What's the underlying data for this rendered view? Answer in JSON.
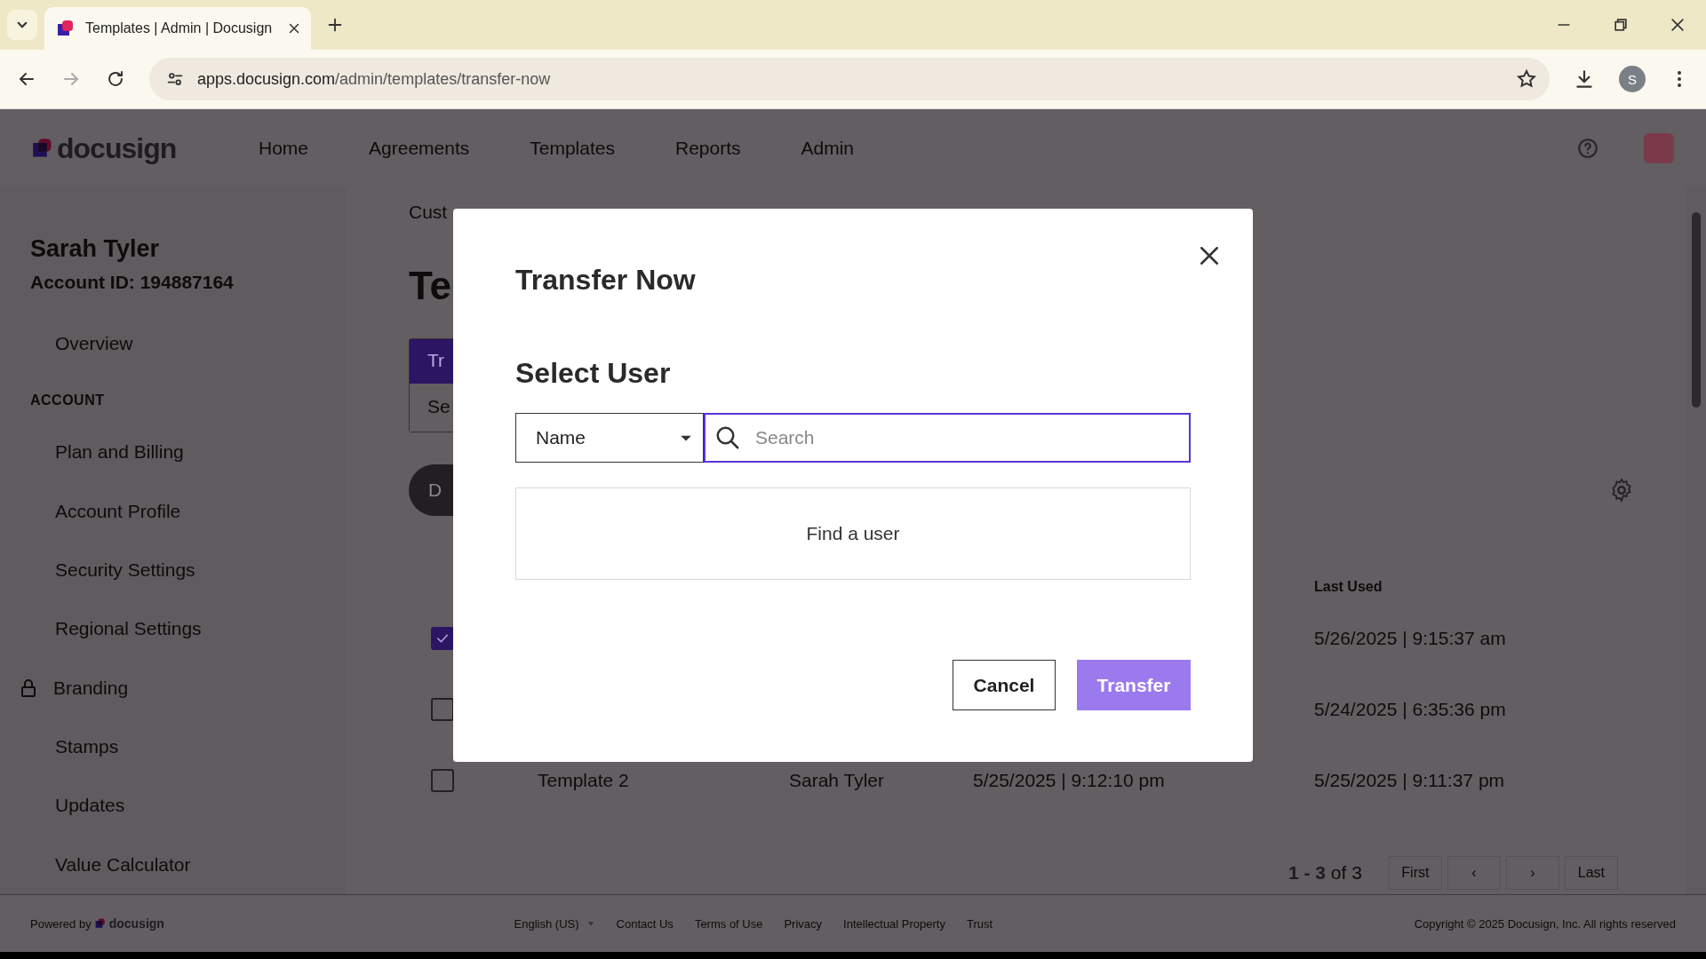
{
  "browser": {
    "tabs": [
      {
        "title": "Templates | Admin | Docusign",
        "selected": true
      }
    ],
    "url_host": "apps.docusign.com",
    "url_path": "/admin/templates/transfer-now",
    "profile_initial": "S"
  },
  "header": {
    "logo": "docusign",
    "nav": [
      {
        "label": "Home"
      },
      {
        "label": "Agreements"
      },
      {
        "label": "Templates"
      },
      {
        "label": "Reports"
      },
      {
        "label": "Admin"
      }
    ]
  },
  "sidebar": {
    "user_name": "Sarah Tyler",
    "account_id": "Account ID: 194887164",
    "items": [
      {
        "kind": "link",
        "label": "Overview",
        "locked": false
      },
      {
        "kind": "section",
        "label": "ACCOUNT"
      },
      {
        "kind": "link",
        "label": "Plan and Billing",
        "locked": false
      },
      {
        "kind": "link",
        "label": "Account Profile",
        "locked": false
      },
      {
        "kind": "link",
        "label": "Security Settings",
        "locked": false
      },
      {
        "kind": "link",
        "label": "Regional Settings",
        "locked": false
      },
      {
        "kind": "link",
        "label": "Branding",
        "locked": true
      },
      {
        "kind": "link",
        "label": "Stamps",
        "locked": false
      },
      {
        "kind": "link",
        "label": "Updates",
        "locked": false
      },
      {
        "kind": "link",
        "label": "Value Calculator",
        "locked": false
      }
    ]
  },
  "main": {
    "breadcrumb": "Cust",
    "title": "Te",
    "panel_header": "Tr",
    "panel_field": "Se",
    "action_button": "D",
    "table": {
      "columns": [
        {
          "label": "Last Used"
        }
      ],
      "rows": [
        {
          "checked": true,
          "last_used": "5/26/2025 | 9:15:37 am"
        },
        {
          "checked": false,
          "last_used": "5/24/2025 | 6:35:36 pm"
        },
        {
          "checked": false,
          "name": "Template 2",
          "owner": "Sarah Tyler",
          "created": "5/25/2025 | 9:12:10 pm",
          "last_used": "5/25/2025 | 9:11:37 pm"
        }
      ]
    },
    "pagination": {
      "range": "**1 - 3** of 3",
      "buttons": [
        "First",
        "‹",
        "›",
        "Last"
      ]
    }
  },
  "modal": {
    "title": "Transfer Now",
    "section_title": "Select User",
    "filter": {
      "value": "Name"
    },
    "search": {
      "placeholder": "Search"
    },
    "empty_text": "Find a user",
    "buttons": [
      {
        "label": "Cancel",
        "kind": "secondary",
        "disabled": false
      },
      {
        "label": "Transfer",
        "kind": "primary",
        "disabled": true
      }
    ]
  },
  "footer": {
    "powered_by": "Powered by",
    "logo": "docusign",
    "language": "English (US)",
    "links": [
      "Contact Us",
      "Terms of Use",
      "Privacy",
      "Intellectual Property",
      "Trust"
    ],
    "copyright": "Copyright © 2025 Docusign, Inc. All rights reserved"
  }
}
